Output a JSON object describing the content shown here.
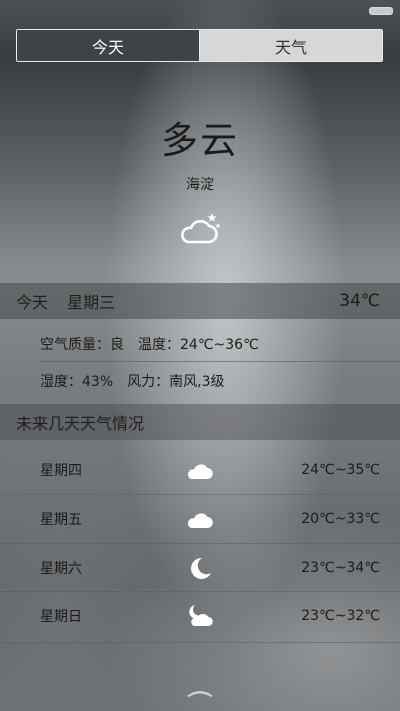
{
  "tabs": [
    {
      "label": "今天",
      "active": true
    },
    {
      "label": "天气",
      "active": false
    }
  ],
  "current": {
    "condition": "多云",
    "location": "海淀",
    "icon": "cloud-night-icon"
  },
  "today": {
    "label": "今天",
    "weekday": "星期三",
    "temperature": "34℃",
    "air_quality": "空气质量：良",
    "temp_range": "温度：24℃~36℃",
    "humidity": "湿度：43%",
    "wind": "风力：南风,3级"
  },
  "forecast": {
    "title": "未来几天天气情况",
    "days": [
      {
        "day": "星期四",
        "icon": "cloud-icon",
        "range": "24℃~35℃"
      },
      {
        "day": "星期五",
        "icon": "cloud-icon",
        "range": "20℃~33℃"
      },
      {
        "day": "星期六",
        "icon": "moon-icon",
        "range": "23℃~34℃"
      },
      {
        "day": "星期日",
        "icon": "moon-cloud-icon",
        "range": "23℃~32℃"
      }
    ]
  },
  "colors": {
    "tab_active_bg": "#3f4346",
    "tab_inactive_bg": "#d6d7d8",
    "icon_color": "#ffffff"
  }
}
